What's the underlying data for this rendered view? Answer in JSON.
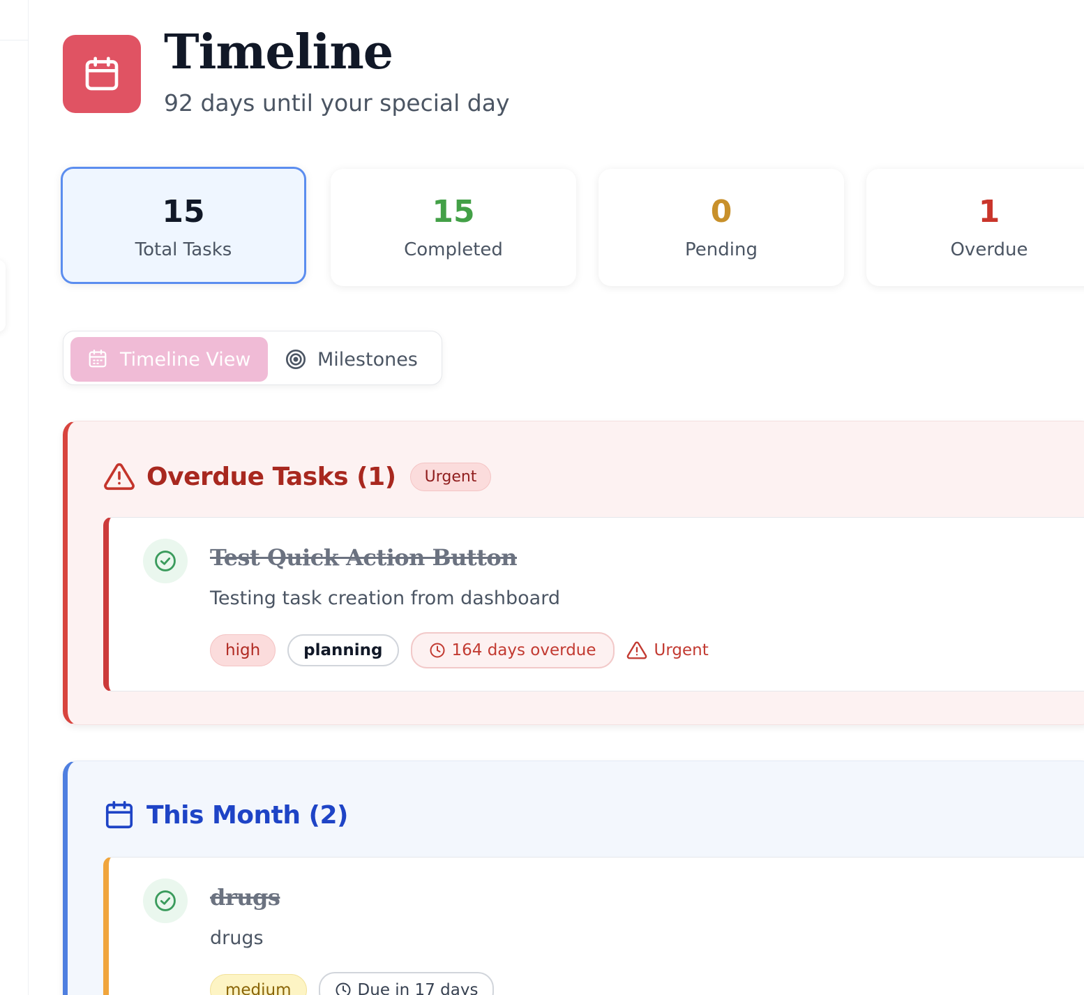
{
  "header": {
    "logo_icon": "calendar-icon",
    "title": "Timeline",
    "subtitle": "92 days until your special day"
  },
  "stats": [
    {
      "value": "15",
      "label": "Total Tasks",
      "color": "#111827",
      "active": true
    },
    {
      "value": "15",
      "label": "Completed",
      "color": "#43a047"
    },
    {
      "value": "0",
      "label": "Pending",
      "color": "#c8902a"
    },
    {
      "value": "1",
      "label": "Overdue",
      "color": "#c9352b"
    }
  ],
  "view_tabs": {
    "timeline": {
      "label": "Timeline View",
      "icon": "calendar-icon",
      "active": true
    },
    "milestones": {
      "label": "Milestones",
      "icon": "target-icon",
      "active": false
    }
  },
  "sections": {
    "overdue": {
      "icon": "warning-triangle-icon",
      "title": "Overdue Tasks (1)",
      "badge": "Urgent",
      "tasks": [
        {
          "title": "Test Quick Action Button",
          "description": "Testing task creation from dashboard",
          "completed": true,
          "priority": "high",
          "category": "planning",
          "due_status": "164 days overdue",
          "flag": "Urgent"
        }
      ]
    },
    "this_month": {
      "icon": "calendar-icon",
      "title": "This Month (2)",
      "tasks": [
        {
          "title": "drugs",
          "description": "drugs",
          "completed": true,
          "priority": "medium",
          "due_status": "Due in 17 days"
        }
      ]
    }
  },
  "colors": {
    "accent_logo": "#e05363",
    "active_tab": "#f0bbd6",
    "overdue_accent": "#d8443e",
    "month_accent": "#4f7fe0",
    "success": "#43a047"
  }
}
